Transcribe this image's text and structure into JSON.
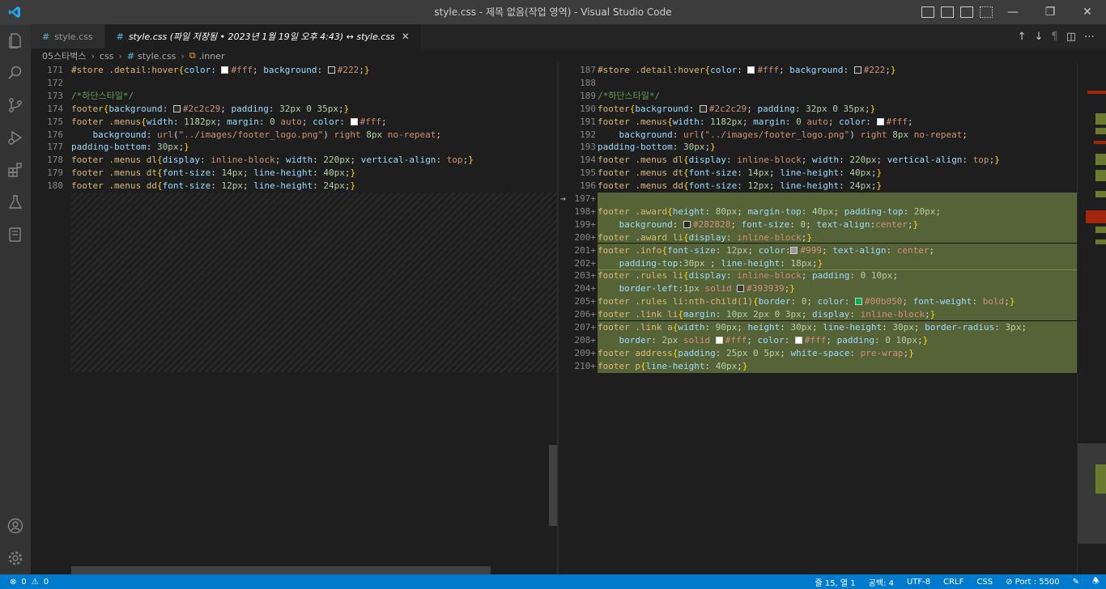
{
  "window": {
    "title": "style.css - 제목 없음(작업 영역) - Visual Studio Code"
  },
  "tabs": [
    {
      "label": "style.css",
      "active": false
    },
    {
      "label": "style.css (파일 저장됨 • 2023년 1월 19일 오후 4:43) ↔ style.css",
      "active": true
    }
  ],
  "breadcrumb": {
    "folder": "05스타벅스",
    "subfolder": "css",
    "file": "style.css",
    "symbol": ".inner"
  },
  "statusbar": {
    "errors": "0",
    "warnings": "0",
    "position": "줄 15, 열 1",
    "spaces": "공백: 4",
    "encoding": "UTF-8",
    "eol": "CRLF",
    "language": "CSS",
    "port": "Port : 5500"
  },
  "left_editor": {
    "lines": [
      {
        "n": "171",
        "html": "<span class='tk-sel'>#store</span> <span class='tk-sel'>.detail:hover</span><span class='tk-br'>{</span><span class='tk-prop'>color</span>: <span class='swatch' style='background:#fff'></span><span class='tk-kw'>#fff</span>; <span class='tk-prop'>background</span>: <span class='swatch' style='background:#222'></span><span class='tk-kw'>#222</span>;<span class='tk-br'>}</span>"
      },
      {
        "n": "172",
        "html": ""
      },
      {
        "n": "173",
        "html": "<span class='tk-cm'>/*하단스타일*/</span>"
      },
      {
        "n": "174",
        "html": "<span class='tk-sel'>footer</span><span class='tk-br'>{</span><span class='tk-prop'>background</span>: <span class='swatch' style='background:#2c2c29'></span><span class='tk-kw'>#2c2c29</span>; <span class='tk-prop'>padding</span>: <span class='tk-num'>32px</span> <span class='tk-num'>0</span> <span class='tk-num'>35px</span>;<span class='tk-br'>}</span>"
      },
      {
        "n": "175",
        "html": "<span class='tk-sel'>footer</span> <span class='tk-sel'>.menus</span><span class='tk-br'>{</span><span class='tk-prop'>width</span>: <span class='tk-num'>1182px</span>; <span class='tk-prop'>margin</span>: <span class='tk-num'>0</span> <span class='tk-kw'>auto</span>; <span class='tk-prop'>color</span>: <span class='swatch' style='background:#fff'></span><span class='tk-kw'>#fff</span>;"
      },
      {
        "n": "176",
        "html": "    <span class='tk-prop'>background</span>: <span class='tk-kw'>url</span>(<span class='tk-str'>\"../images/footer_logo.png\"</span>) <span class='tk-kw'>right</span> <span class='tk-num'>8px</span> <span class='tk-kw'>no-repeat</span>;"
      },
      {
        "n": "177",
        "html": "<span class='tk-prop'>padding-bottom</span>: <span class='tk-num'>30px</span>;<span class='tk-br'>}</span>"
      },
      {
        "n": "178",
        "html": "<span class='tk-sel'>footer</span> <span class='tk-sel'>.menus</span> <span class='tk-sel'>dl</span><span class='tk-br'>{</span><span class='tk-prop'>display</span>: <span class='tk-kw'>inline-block</span>; <span class='tk-prop'>width</span>: <span class='tk-num'>220px</span>; <span class='tk-prop'>vertical-align</span>: <span class='tk-kw'>top</span>;<span class='tk-br'>}</span>"
      },
      {
        "n": "179",
        "html": "<span class='tk-sel'>footer</span> <span class='tk-sel'>.menus</span> <span class='tk-sel'>dt</span><span class='tk-br'>{</span><span class='tk-prop'>font-size</span>: <span class='tk-num'>14px</span>; <span class='tk-prop'>line-height</span>: <span class='tk-num'>40px</span>;<span class='tk-br'>}</span>"
      },
      {
        "n": "180",
        "html": "<span class='tk-sel'>footer</span> <span class='tk-sel'>.menus</span> <span class='tk-sel'>dd</span><span class='tk-br'>{</span><span class='tk-prop'>font-size</span>: <span class='tk-num'>12px</span>; <span class='tk-prop'>line-height</span>: <span class='tk-num'>24px</span>;<span class='tk-br'>}</span>"
      }
    ]
  },
  "right_editor": {
    "lines": [
      {
        "n": "187",
        "ins": false,
        "html": "<span class='tk-sel'>#store</span> <span class='tk-sel'>.detail:hover</span><span class='tk-br'>{</span><span class='tk-prop'>color</span>: <span class='swatch' style='background:#fff'></span><span class='tk-kw'>#fff</span>; <span class='tk-prop'>background</span>: <span class='swatch' style='background:#222'></span><span class='tk-kw'>#222</span>;<span class='tk-br'>}</span>"
      },
      {
        "n": "188",
        "ins": false,
        "html": ""
      },
      {
        "n": "189",
        "ins": false,
        "html": "<span class='tk-cm'>/*하단스타일*/</span>"
      },
      {
        "n": "190",
        "ins": false,
        "html": "<span class='tk-sel'>footer</span><span class='tk-br'>{</span><span class='tk-prop'>background</span>: <span class='swatch' style='background:#2c2c29'></span><span class='tk-kw'>#2c2c29</span>; <span class='tk-prop'>padding</span>: <span class='tk-num'>32px</span> <span class='tk-num'>0</span> <span class='tk-num'>35px</span>;<span class='tk-br'>}</span>"
      },
      {
        "n": "191",
        "ins": false,
        "html": "<span class='tk-sel'>footer</span> <span class='tk-sel'>.menus</span><span class='tk-br'>{</span><span class='tk-prop'>width</span>: <span class='tk-num'>1182px</span>; <span class='tk-prop'>margin</span>: <span class='tk-num'>0</span> <span class='tk-kw'>auto</span>; <span class='tk-prop'>color</span>: <span class='swatch' style='background:#fff'></span><span class='tk-kw'>#fff</span>;"
      },
      {
        "n": "192",
        "ins": false,
        "html": "    <span class='tk-prop'>background</span>: <span class='tk-kw'>url</span>(<span class='tk-str'>\"../images/footer_logo.png\"</span>) <span class='tk-kw'>right</span> <span class='tk-num'>8px</span> <span class='tk-kw'>no-repeat</span>;"
      },
      {
        "n": "193",
        "ins": false,
        "html": "<span class='tk-prop'>padding-bottom</span>: <span class='tk-num'>30px</span>;<span class='tk-br'>}</span>"
      },
      {
        "n": "194",
        "ins": false,
        "html": "<span class='tk-sel'>footer</span> <span class='tk-sel'>.menus</span> <span class='tk-sel'>dl</span><span class='tk-br'>{</span><span class='tk-prop'>display</span>: <span class='tk-kw'>inline-block</span>; <span class='tk-prop'>width</span>: <span class='tk-num'>220px</span>; <span class='tk-prop'>vertical-align</span>: <span class='tk-kw'>top</span>;<span class='tk-br'>}</span>"
      },
      {
        "n": "195",
        "ins": false,
        "html": "<span class='tk-sel'>footer</span> <span class='tk-sel'>.menus</span> <span class='tk-sel'>dt</span><span class='tk-br'>{</span><span class='tk-prop'>font-size</span>: <span class='tk-num'>14px</span>; <span class='tk-prop'>line-height</span>: <span class='tk-num'>40px</span>;<span class='tk-br'>}</span>"
      },
      {
        "n": "196",
        "ins": false,
        "html": "<span class='tk-sel'>footer</span> <span class='tk-sel'>.menus</span> <span class='tk-sel'>dd</span><span class='tk-br'>{</span><span class='tk-prop'>font-size</span>: <span class='tk-num'>12px</span>; <span class='tk-prop'>line-height</span>: <span class='tk-num'>24px</span>;<span class='tk-br'>}</span>"
      },
      {
        "n": "197+",
        "ins": true,
        "arrow": true,
        "html": ""
      },
      {
        "n": "198+",
        "ins": true,
        "html": "<span class='tk-sel'>footer</span> <span class='tk-sel'>.award</span><span class='tk-br'>{</span><span class='tk-prop'>height</span>: <span class='tk-num'>80px</span>; <span class='tk-prop'>margin-top</span>: <span class='tk-num'>40px</span>; <span class='tk-prop'>padding-top</span>: <span class='tk-num'>20px</span>;"
      },
      {
        "n": "199+",
        "ins": true,
        "html": "    <span class='tk-prop'>background</span>: <span class='swatch' style='background:#282828'></span><span class='tk-kw'>#282828</span>; <span class='tk-prop'>font-size</span>: <span class='tk-num'>0</span>; <span class='tk-prop'>text-align</span>:<span class='tk-kw'>center</span>;<span class='tk-br'>}</span>"
      },
      {
        "n": "200+",
        "ins": true,
        "html": "<span class='tk-sel'>footer</span> <span class='tk-sel'>.award</span> <span class='tk-sel'>li</span><span class='tk-br'>{</span><span class='tk-prop'>display</span>: <span class='tk-kw'>inline-block</span>;<span class='tk-br'>}</span>"
      },
      {
        "n": "201+",
        "ins": true,
        "html": "<span class='tk-sel'>footer</span> <span class='tk-sel'>.info</span><span class='tk-br'>{</span><span class='tk-prop'>font-size</span>: <span class='tk-num'>12px</span>; <span class='tk-prop'>color</span>:<span class='swatch' style='background:#999'></span><span class='tk-kw'>#999</span>; <span class='tk-prop'>text-align</span>: <span class='tk-kw'>center</span>;"
      },
      {
        "n": "202+",
        "ins": true,
        "html": "    <span class='tk-prop'>padding-top</span>:<span class='tk-num'>30px</span> ; <span class='tk-prop'>line-height</span>: <span class='tk-num'>18px</span>;<span class='tk-br'>}</span>"
      },
      {
        "n": "203+",
        "ins": true,
        "html": "<span class='tk-sel'>footer</span> <span class='tk-sel'>.rules</span> <span class='tk-sel'>li</span><span class='tk-br'>{</span><span class='tk-prop'>display</span>: <span class='tk-kw'>inline-block</span>; <span class='tk-prop'>padding</span>: <span class='tk-num'>0</span> <span class='tk-num'>10px</span>;"
      },
      {
        "n": "204+",
        "ins": true,
        "html": "    <span class='tk-prop'>border-left</span>:<span class='tk-num'>1px</span> <span class='tk-kw'>solid</span> <span class='swatch' style='background:#393939'></span><span class='tk-kw'>#393939</span>;<span class='tk-br'>}</span>"
      },
      {
        "n": "205+",
        "ins": true,
        "html": "<span class='tk-sel'>footer</span> <span class='tk-sel'>.rules</span> <span class='tk-sel'>li:nth-child(1)</span><span class='tk-br'>{</span><span class='tk-prop'>border</span>: <span class='tk-num'>0</span>; <span class='tk-prop'>color</span>: <span class='swatch' style='background:#00b050'></span><span class='tk-kw'>#00b050</span>; <span class='tk-prop'>font-weight</span>: <span class='tk-kw'>bold</span>;<span class='tk-br'>}</span>"
      },
      {
        "n": "206+",
        "ins": true,
        "html": "<span class='tk-sel'>footer</span> <span class='tk-sel'>.link</span> <span class='tk-sel'>li</span><span class='tk-br'>{</span><span class='tk-prop'>margin</span>: <span class='tk-num'>10px</span> <span class='tk-num'>2px</span> <span class='tk-num'>0</span> <span class='tk-num'>3px</span>; <span class='tk-prop'>display</span>: <span class='tk-kw'>inline-block</span>;<span class='tk-br'>}</span>"
      },
      {
        "n": "207+",
        "ins": true,
        "html": "<span class='tk-sel'>footer</span> <span class='tk-sel'>.link</span> <span class='tk-sel'>a</span><span class='tk-br'>{</span><span class='tk-prop'>width</span>: <span class='tk-num'>90px</span>; <span class='tk-prop'>height</span>: <span class='tk-num'>30px</span>; <span class='tk-prop'>line-height</span>: <span class='tk-num'>30px</span>; <span class='tk-prop'>border-radius</span>: <span class='tk-num'>3px</span>;"
      },
      {
        "n": "208+",
        "ins": true,
        "html": "    <span class='tk-prop'>border</span>: <span class='tk-num'>2px</span> <span class='tk-kw'>solid</span> <span class='swatch' style='background:#fff'></span><span class='tk-kw'>#fff</span>; <span class='tk-prop'>color</span>: <span class='swatch' style='background:#fff'></span><span class='tk-kw'>#fff</span>; <span class='tk-prop'>padding</span>: <span class='tk-num'>0</span> <span class='tk-num'>10px</span>;<span class='tk-br'>}</span>"
      },
      {
        "n": "209+",
        "ins": true,
        "html": "<span class='tk-sel'>footer</span> <span class='tk-sel'>address</span><span class='tk-br'>{</span><span class='tk-prop'>padding</span>: <span class='tk-num'>25px</span> <span class='tk-num'>0</span> <span class='tk-num'>5px</span>; <span class='tk-prop'>white-space</span>: <span class='tk-kw'>pre-wrap</span>;<span class='tk-br'>}</span>"
      },
      {
        "n": "210+",
        "ins": true,
        "html": "<span class='tk-sel'>footer</span> <span class='tk-sel'>p</span><span class='tk-br'>{</span><span class='tk-prop'>line-height</span>: <span class='tk-num'>40px</span>;<span class='tk-br'>}</span>"
      }
    ]
  }
}
